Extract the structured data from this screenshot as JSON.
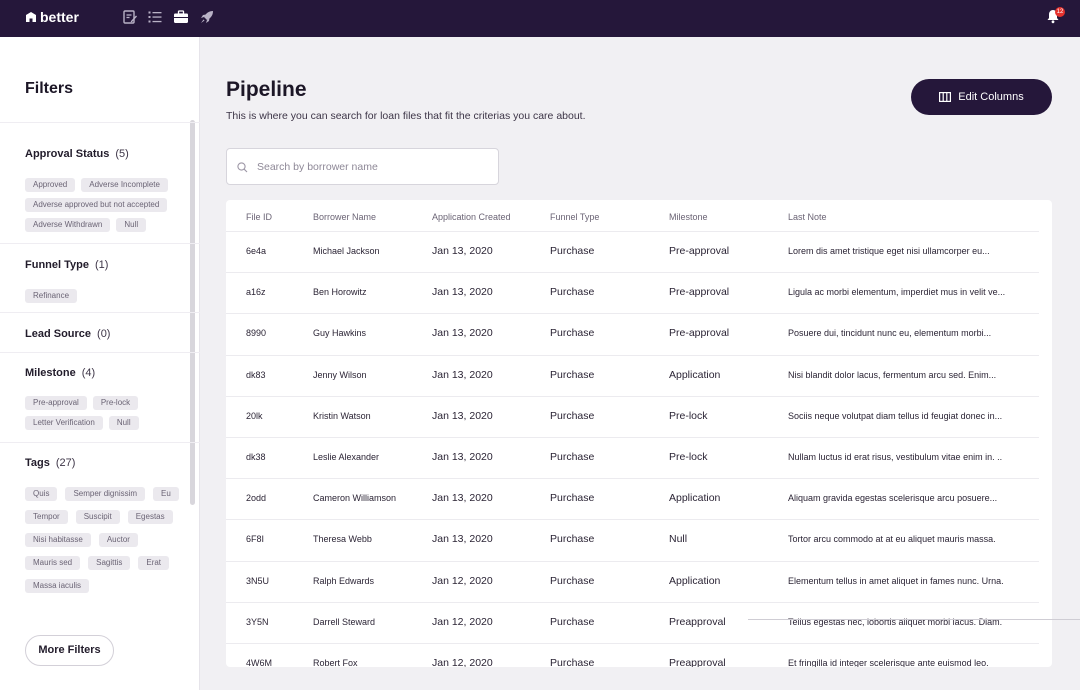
{
  "brand": {
    "name": "better"
  },
  "topbar": {
    "nav_icons": [
      "edit-document-icon",
      "list-icon",
      "briefcase-icon",
      "rocket-icon"
    ],
    "notification_count": "12"
  },
  "sidebar": {
    "title": "Filters",
    "groups": [
      {
        "name": "Approval Status",
        "count": "(5)",
        "chips": [
          "Approved",
          "Adverse Incomplete",
          "Adverse approved but not accepted",
          "Adverse Withdrawn",
          "Null"
        ]
      },
      {
        "name": "Funnel Type",
        "count": "(1)",
        "chips": [
          "Refinance"
        ]
      },
      {
        "name": "Lead Source",
        "count": "(0)",
        "chips": []
      },
      {
        "name": "Milestone",
        "count": "(4)",
        "chips": [
          "Pre-approval",
          "Pre-lock",
          "Letter Verification",
          "Null"
        ]
      },
      {
        "name": "Tags",
        "count": "(27)",
        "chips": [
          "Quis",
          "Semper dignissim",
          "Eu",
          "Tempor",
          "Suscipit",
          "Egestas",
          "Nisi habitasse",
          "Auctor",
          "Mauris sed",
          "Sagittis",
          "Erat",
          "Massa iaculis"
        ]
      }
    ],
    "more_filters_label": "More Filters"
  },
  "main": {
    "title": "Pipeline",
    "subtitle": "This is where you can search for loan files that fit the criterias you care about.",
    "edit_columns_label": "Edit Columns",
    "search_placeholder": "Search by borrower name"
  },
  "table": {
    "headers": [
      "File ID",
      "Borrower Name",
      "Application Created",
      "Funnel Type",
      "Milestone",
      "Last Note"
    ],
    "rows": [
      [
        "6e4a",
        "Michael Jackson",
        "Jan 13, 2020",
        "Purchase",
        "Pre-approval",
        "Lorem dis amet tristique eget nisi ullamcorper eu..."
      ],
      [
        "a16z",
        "Ben Horowitz",
        "Jan 13, 2020",
        "Purchase",
        "Pre-approval",
        "Ligula ac morbi elementum, imperdiet mus in velit ve..."
      ],
      [
        "8990",
        "Guy Hawkins",
        "Jan 13, 2020",
        "Purchase",
        "Pre-approval",
        "Posuere dui, tincidunt nunc eu, elementum morbi..."
      ],
      [
        "dk83",
        "Jenny Wilson",
        "Jan 13, 2020",
        "Purchase",
        "Application",
        "Nisi blandit dolor lacus, fermentum arcu sed. Enim..."
      ],
      [
        "20lk",
        "Kristin Watson",
        "Jan 13, 2020",
        "Purchase",
        "Pre-lock",
        "Sociis neque volutpat diam tellus id feugiat donec in..."
      ],
      [
        "dk38",
        "Leslie Alexander",
        "Jan 13, 2020",
        "Purchase",
        "Pre-lock",
        "Nullam luctus id erat risus, vestibulum vitae enim in. .."
      ],
      [
        "2odd",
        "Cameron Williamson",
        "Jan 13, 2020",
        "Purchase",
        "Application",
        "Aliquam gravida egestas scelerisque arcu posuere..."
      ],
      [
        "6F8I",
        "Theresa Webb",
        "Jan 13, 2020",
        "Purchase",
        "Null",
        "Tortor arcu commodo at at eu aliquet mauris massa."
      ],
      [
        "3N5U",
        "Ralph Edwards",
        "Jan 12, 2020",
        "Purchase",
        "Application",
        "Elementum tellus in amet aliquet in fames nunc. Urna."
      ],
      [
        "3Y5N",
        "Darrell Steward",
        "Jan 12, 2020",
        "Purchase",
        "Preapproval",
        "Tellus egestas nec, lobortis aliquet morbi lacus. Diam."
      ],
      [
        "4W6M",
        "Robert Fox",
        "Jan 12, 2020",
        "Purchase",
        "Preapproval",
        "Et fringilla id integer scelerisque ante euismod leo."
      ]
    ]
  }
}
